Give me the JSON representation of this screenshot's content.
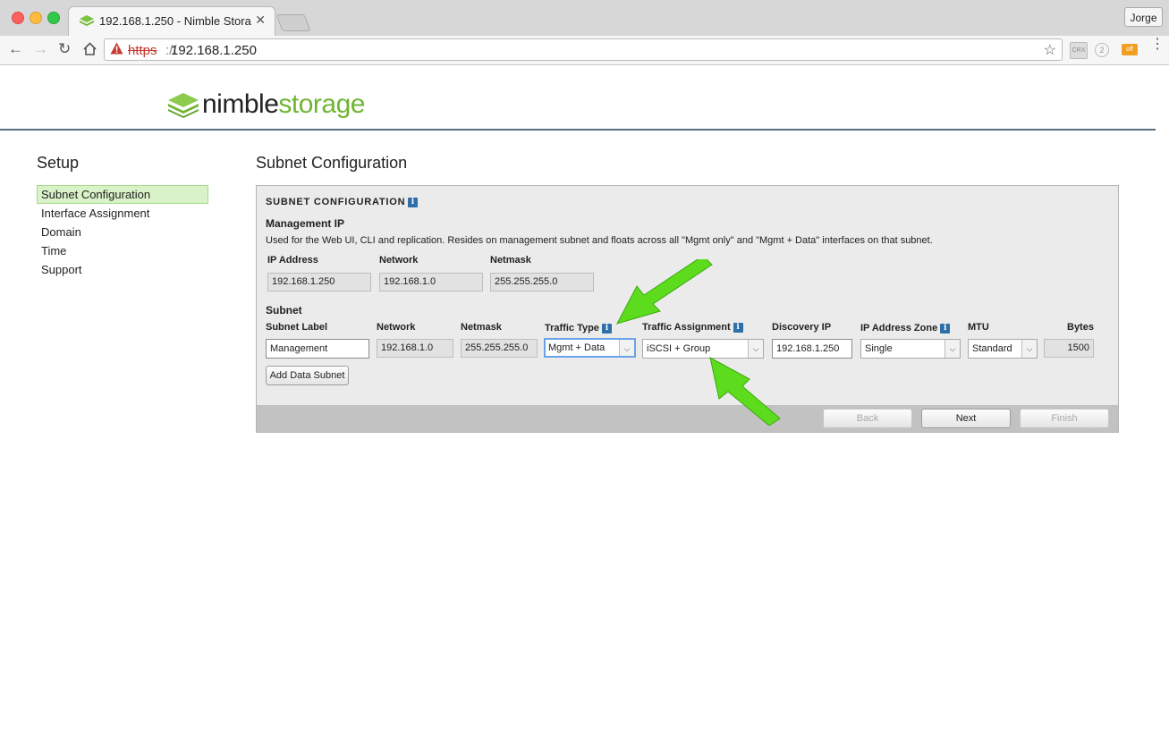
{
  "browser": {
    "tab_title": "192.168.1.250 - Nimble Stora",
    "profile": "Jorge",
    "url_scheme": "https",
    "url_sep": "://",
    "url_host": "192.168.1.250",
    "extensions": [
      "CRX",
      "2",
      "off"
    ]
  },
  "brand": {
    "part1": "nimble",
    "part2": "storage"
  },
  "sidebar": {
    "title": "Setup",
    "items": [
      {
        "label": "Subnet Configuration",
        "active": true
      },
      {
        "label": "Interface Assignment"
      },
      {
        "label": "Domain"
      },
      {
        "label": "Time"
      },
      {
        "label": "Support"
      }
    ]
  },
  "main": {
    "title": "Subnet Configuration",
    "panel_heading": "SUBNET CONFIGURATION",
    "management": {
      "heading": "Management IP",
      "description": "Used for the Web UI, CLI and replication. Resides on management subnet and floats across all \"Mgmt only\" and \"Mgmt + Data\" interfaces on that subnet.",
      "headers": {
        "ip": "IP Address",
        "network": "Network",
        "netmask": "Netmask"
      },
      "values": {
        "ip": "192.168.1.250",
        "network": "192.168.1.0",
        "netmask": "255.255.255.0"
      }
    },
    "subnet": {
      "heading": "Subnet",
      "headers": {
        "label": "Subnet Label",
        "network": "Network",
        "netmask": "Netmask",
        "traffic_type": "Traffic Type",
        "traffic_assignment": "Traffic Assignment",
        "discovery_ip": "Discovery IP",
        "zone": "IP Address Zone",
        "mtu": "MTU",
        "bytes": "Bytes"
      },
      "row": {
        "label": "Management",
        "network": "192.168.1.0",
        "netmask": "255.255.255.0",
        "traffic_type": "Mgmt + Data",
        "traffic_assignment": "iSCSI + Group",
        "discovery_ip": "192.168.1.250",
        "zone": "Single",
        "mtu": "Standard",
        "bytes": "1500"
      },
      "add_button": "Add Data Subnet"
    },
    "buttons": {
      "back": "Back",
      "next": "Next",
      "finish": "Finish"
    }
  },
  "colors": {
    "accent_green": "#6fb530",
    "annotation_arrow": "#5ddc1d",
    "header_rule": "#5a6f7f"
  }
}
